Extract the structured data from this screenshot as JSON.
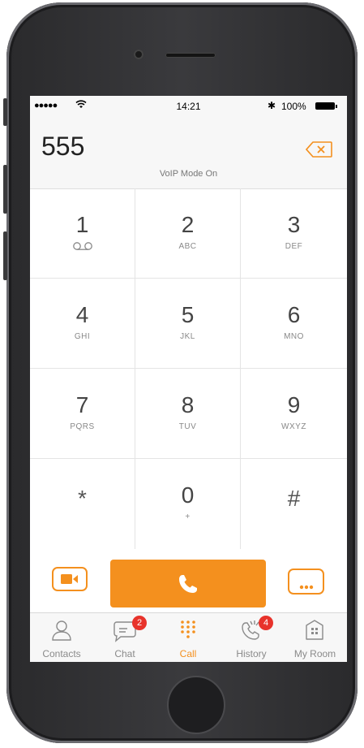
{
  "status_bar": {
    "signal": "●●●●●",
    "time": "14:21",
    "bluetooth": "✱",
    "battery": "100%"
  },
  "dial": {
    "number": "555",
    "mode": "VoIP Mode On"
  },
  "keys": [
    {
      "digit": "1",
      "letters": ""
    },
    {
      "digit": "2",
      "letters": "ABC"
    },
    {
      "digit": "3",
      "letters": "DEF"
    },
    {
      "digit": "4",
      "letters": "GHI"
    },
    {
      "digit": "5",
      "letters": "JKL"
    },
    {
      "digit": "6",
      "letters": "MNO"
    },
    {
      "digit": "7",
      "letters": "PQRS"
    },
    {
      "digit": "8",
      "letters": "TUV"
    },
    {
      "digit": "9",
      "letters": "WXYZ"
    },
    {
      "digit": "*",
      "letters": ""
    },
    {
      "digit": "0",
      "letters": "+"
    },
    {
      "digit": "#",
      "letters": ""
    }
  ],
  "tabs": [
    {
      "label": "Contacts",
      "icon": "contacts-icon",
      "badge": ""
    },
    {
      "label": "Chat",
      "icon": "chat-icon",
      "badge": "2"
    },
    {
      "label": "Call",
      "icon": "dialpad-icon",
      "badge": ""
    },
    {
      "label": "History",
      "icon": "history-icon",
      "badge": "4"
    },
    {
      "label": "My Room",
      "icon": "room-icon",
      "badge": ""
    }
  ],
  "colors": {
    "accent": "#f4901e",
    "badge": "#e8332b",
    "inactive": "#8a8a8a"
  }
}
